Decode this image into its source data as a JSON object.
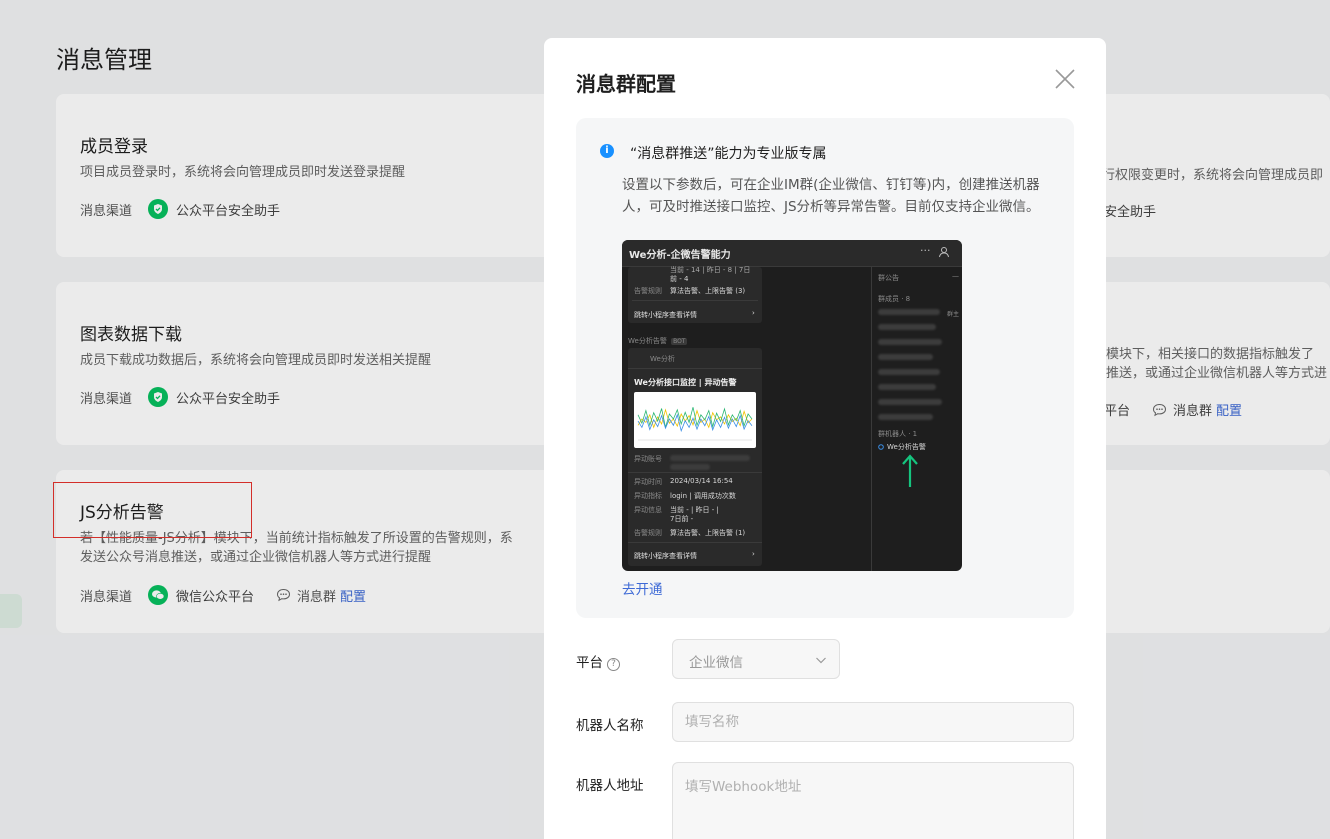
{
  "page": {
    "title": "消息管理"
  },
  "cards": [
    {
      "title": "成员登录",
      "desc": "项目成员登录时，系统将会向管理成员即时发送登录提醒",
      "channel_label": "消息渠道",
      "channel": "公众平台安全助手"
    },
    {
      "title": "图表数据下载",
      "desc": "成员下载成功数据后，系统将会向管理成员即时发送相关提醒",
      "channel_label": "消息渠道",
      "channel": "公众平台安全助手"
    },
    {
      "title": "JS分析告警",
      "desc_line1": "若【性能质量-JS分析】模块下，当前统计指标触发了所设置的告警规则，系",
      "desc_line2": "发送公众号消息推送，或通过企业微信机器人等方式进行提醒",
      "channel_label": "消息渠道",
      "channel": "微信公众平台",
      "group_label": "消息群",
      "config_link": "配置"
    }
  ],
  "right_cards": {
    "card1_desc": "行权限变更时，系统将会向管理成员即",
    "card1_channel": "安全助手",
    "card2_desc1": "模块下，相关接口的数据指标触发了",
    "card2_desc2": "推送，或通过企业微信机器人等方式进",
    "card2_channel": "平台",
    "card2_group": "消息群",
    "card2_config": "配置"
  },
  "modal": {
    "title": "消息群配置",
    "info": {
      "title": "“消息群推送”能力为专业版专属",
      "desc": "设置以下参数后，可在企业IM群(企业微信、钉钉等)内，创建推送机器人，可及时推送接口监控、JS分析等异常告警。目前仅支持企业微信。",
      "open_link": "去开通"
    },
    "preview": {
      "header": "We分析-企微告警能力",
      "dots": "···",
      "top_rows": [
        {
          "label": "告警规则",
          "value": "算法告警、上限告警 (3)"
        }
      ],
      "top_partial": "当前 - 14 | 昨日 - 8 | 7日",
      "top_partial2": "前 - 4",
      "jump1": "跳转小程序查看详情",
      "sender": "We分析告警",
      "bot_tag": "BOT",
      "card_app": "We分析",
      "card_title": "We分析接口监控 | 异动告警",
      "account_label": "异动账号",
      "rows": [
        {
          "label": "异动时间",
          "value": "2024/03/14 16:54"
        },
        {
          "label": "异动指标",
          "value": "login | 调用成功次数"
        },
        {
          "label": "异动信息",
          "value": "当前 -       | 昨日 -       |"
        },
        {
          "label": "",
          "value": "7日前 -"
        },
        {
          "label": "告警规则",
          "value": "算法告警、上限告警 (1)"
        }
      ],
      "jump2": "跳转小程序查看详情",
      "right_notice": "群公告",
      "right_members": "群成员 · 8",
      "right_owner": "群主",
      "right_bots": "群机器人 · 1",
      "right_bot_name": "We分析告警",
      "chart_series": {
        "series_a": [
          0.35,
          0.5,
          0.42,
          0.6,
          0.3,
          0.55,
          0.38,
          0.72,
          0.4,
          0.5,
          0.33,
          0.62,
          0.45,
          0.58,
          0.36,
          0.7,
          0.42,
          0.5,
          0.3,
          0.65,
          0.48,
          0.55,
          0.38,
          0.6,
          0.44,
          0.52,
          0.34,
          0.68,
          0.41,
          0.5
        ],
        "series_b": [
          0.6,
          0.4,
          0.7,
          0.35,
          0.65,
          0.45,
          0.75,
          0.3,
          0.62,
          0.5,
          0.72,
          0.38,
          0.66,
          0.42,
          0.78,
          0.35,
          0.6,
          0.48,
          0.7,
          0.32,
          0.64,
          0.44,
          0.74,
          0.36,
          0.6,
          0.46,
          0.7,
          0.34,
          0.62,
          0.5
        ],
        "series_c": [
          0.45,
          0.3,
          0.55,
          0.25,
          0.48,
          0.32,
          0.58,
          0.28,
          0.5,
          0.35,
          0.6,
          0.22,
          0.46,
          0.3,
          0.52,
          0.26,
          0.5,
          0.34,
          0.56,
          0.24,
          0.48,
          0.3,
          0.54,
          0.28,
          0.5,
          0.32,
          0.58,
          0.26,
          0.46,
          0.34
        ]
      }
    },
    "form": {
      "platform_label": "平台",
      "platform_value": "企业微信",
      "bot_name_label": "机器人名称",
      "bot_name_placeholder": "填写名称",
      "bot_addr_label": "机器人地址",
      "bot_addr_placeholder": "填写Webhook地址"
    }
  },
  "colors": {
    "accent": "#3e6ad6",
    "wechat_green": "#07c160",
    "info_blue": "#1890ff",
    "highlight_red": "#e5322d"
  }
}
